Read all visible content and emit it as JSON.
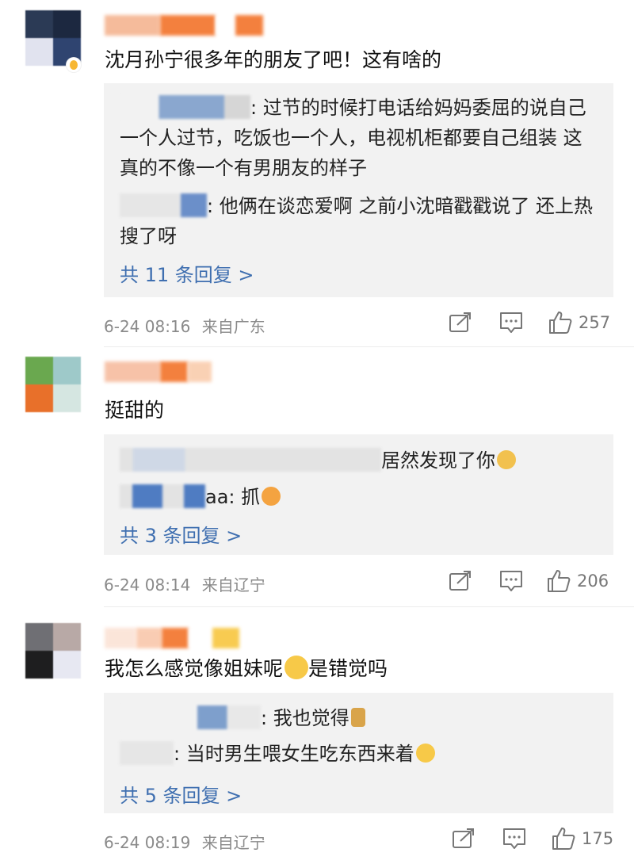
{
  "colors": {
    "link": "#3f6fb0",
    "meta": "#8a8a8a",
    "reply_bg": "#f2f2f2"
  },
  "comments": [
    {
      "avatar_colors": [
        "#2b3a55",
        "#1c2840",
        "#e1e3ef",
        "#2f4470"
      ],
      "text": "沈月孙宁很多年的朋友了吧！这有啥的",
      "replies": [
        {
          "suffix": ": 过节的时候打电话给妈妈委屈的说自己一个人过节，吃饭也一个人，电视机柜都要自己组装 这真的不像一个有男朋友的样子"
        },
        {
          "suffix": ": 他俩在谈恋爱啊 之前小沈暗戳戳说了 还上热搜了呀"
        }
      ],
      "more": "共 11 条回复 >",
      "time": "6-24 08:16",
      "location": "来自广东",
      "likes": "257"
    },
    {
      "avatar_colors": [
        "#6aa84f",
        "#9ec9c9",
        "#e8702a",
        "#d5e6e1"
      ],
      "text": "挺甜的",
      "replies": [
        {
          "suffix": "居然发现了你",
          "emoji": "doge-emoji"
        },
        {
          "suffix": "aa: 抓",
          "emoji": "grab-emoji"
        }
      ],
      "more": "共 3 条回复 >",
      "time": "6-24 08:14",
      "location": "来自辽宁",
      "likes": "206"
    },
    {
      "avatar_colors": [
        "#6f6f74",
        "#b8a9a6",
        "#1e1e1f",
        "#e7e8f2"
      ],
      "text": "我怎么感觉像姐妹呢",
      "text_emoji": "crying-emoji",
      "text_after": "是错觉吗",
      "replies": [
        {
          "suffix": ": 我也觉得",
          "emoji": "figure-emoji"
        },
        {
          "suffix": ": 当时男生喂女生吃东西来着",
          "emoji": "laugh-cry-emoji"
        }
      ],
      "more": "共 5 条回复 >",
      "time": "6-24 08:19",
      "location": "来自辽宁",
      "likes": "175"
    }
  ],
  "icons": {
    "share": "share-icon",
    "comment": "comment-icon",
    "like": "like-icon"
  }
}
